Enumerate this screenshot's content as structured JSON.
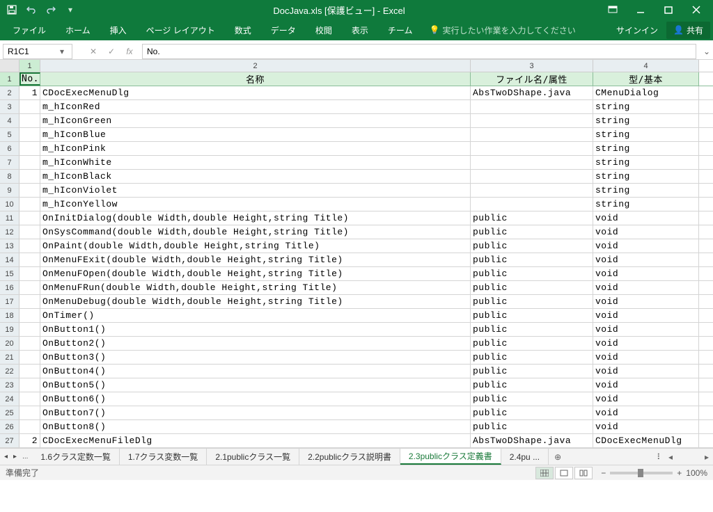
{
  "title": "DocJava.xls  [保護ビュー] - Excel",
  "ribbon": {
    "tabs": [
      "ファイル",
      "ホーム",
      "挿入",
      "ページ レイアウト",
      "数式",
      "データ",
      "校閲",
      "表示",
      "チーム"
    ],
    "tell_me": "実行したい作業を入力してください",
    "signin": "サインイン",
    "share": "共有"
  },
  "namebox": "R1C1",
  "fx_label": "fx",
  "formula": "No.",
  "columns": [
    "1",
    "2",
    "3",
    "4"
  ],
  "headers": {
    "c1": "No.",
    "c2": "名称",
    "c3": "ファイル名/属性",
    "c4": "型/基本"
  },
  "rows": [
    {
      "n": "1",
      "c2": "CDocExecMenuDlg",
      "c3": "AbsTwoDShape.java",
      "c4": "CMenuDialog"
    },
    {
      "n": "",
      "c2": "m_hIconRed",
      "c3": "",
      "c4": "string"
    },
    {
      "n": "",
      "c2": "m_hIconGreen",
      "c3": "",
      "c4": "string"
    },
    {
      "n": "",
      "c2": "m_hIconBlue",
      "c3": "",
      "c4": "string"
    },
    {
      "n": "",
      "c2": "m_hIconPink",
      "c3": "",
      "c4": "string"
    },
    {
      "n": "",
      "c2": "m_hIconWhite",
      "c3": "",
      "c4": "string"
    },
    {
      "n": "",
      "c2": "m_hIconBlack",
      "c3": "",
      "c4": "string"
    },
    {
      "n": "",
      "c2": "m_hIconViolet",
      "c3": "",
      "c4": "string"
    },
    {
      "n": "",
      "c2": "m_hIconYellow",
      "c3": "",
      "c4": "string"
    },
    {
      "n": "",
      "c2": "OnInitDialog(double Width,double Height,string Title)",
      "c3": "public",
      "c4": "void"
    },
    {
      "n": "",
      "c2": "OnSysCommand(double Width,double Height,string Title)",
      "c3": "public",
      "c4": "void"
    },
    {
      "n": "",
      "c2": "OnPaint(double Width,double Height,string Title)",
      "c3": "public",
      "c4": "void"
    },
    {
      "n": "",
      "c2": "OnMenuFExit(double Width,double Height,string Title)",
      "c3": "public",
      "c4": "void"
    },
    {
      "n": "",
      "c2": "OnMenuFOpen(double Width,double Height,string Title)",
      "c3": "public",
      "c4": "void"
    },
    {
      "n": "",
      "c2": "OnMenuFRun(double Width,double Height,string Title)",
      "c3": "public",
      "c4": "void"
    },
    {
      "n": "",
      "c2": "OnMenuDebug(double Width,double Height,string Title)",
      "c3": "public",
      "c4": "void"
    },
    {
      "n": "",
      "c2": "OnTimer()",
      "c3": "public",
      "c4": "void"
    },
    {
      "n": "",
      "c2": "OnButton1()",
      "c3": "public",
      "c4": "void"
    },
    {
      "n": "",
      "c2": "OnButton2()",
      "c3": "public",
      "c4": "void"
    },
    {
      "n": "",
      "c2": "OnButton3()",
      "c3": "public",
      "c4": "void"
    },
    {
      "n": "",
      "c2": "OnButton4()",
      "c3": "public",
      "c4": "void"
    },
    {
      "n": "",
      "c2": "OnButton5()",
      "c3": "public",
      "c4": "void"
    },
    {
      "n": "",
      "c2": "OnButton6()",
      "c3": "public",
      "c4": "void"
    },
    {
      "n": "",
      "c2": "OnButton7()",
      "c3": "public",
      "c4": "void"
    },
    {
      "n": "",
      "c2": "OnButton8()",
      "c3": "public",
      "c4": "void"
    },
    {
      "n": "2",
      "c2": "CDocExecMenuFileDlg",
      "c3": "AbsTwoDShape.java",
      "c4": "CDocExecMenuDlg"
    }
  ],
  "tabs": {
    "overflow": "...",
    "items": [
      "1.6クラス定数一覧",
      "1.7クラス変数一覧",
      "2.1publicクラス一覧",
      "2.2publicクラス説明書",
      "2.3publicクラス定義書",
      "2.4pu ..."
    ],
    "active_index": 4
  },
  "status": {
    "ready": "準備完了",
    "zoom": "100%"
  }
}
